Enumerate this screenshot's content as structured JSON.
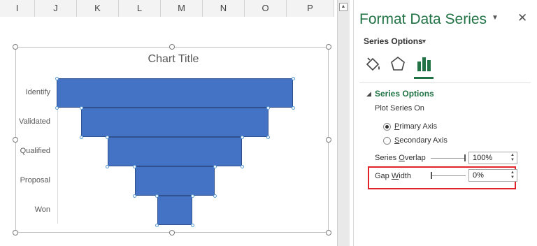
{
  "sheet": {
    "columns": [
      "I",
      "J",
      "K",
      "L",
      "M",
      "N",
      "O",
      "P"
    ]
  },
  "chart": {
    "title": "Chart Title"
  },
  "chart_data": {
    "type": "bar",
    "orientation": "horizontal",
    "style": "funnel",
    "title": "Chart Title",
    "categories": [
      "Identify",
      "Validated",
      "Qualified",
      "Proposal",
      "Won"
    ],
    "values": [
      100,
      79,
      57,
      34,
      15
    ],
    "color": "#4472c4",
    "gap_width_percent": 0,
    "series_overlap_percent": 100,
    "grid": false,
    "legend": "none"
  },
  "pane": {
    "title": "Format Data Series",
    "menu_label": "Series Options",
    "icons": [
      "fill-line-icon",
      "effects-icon",
      "series-options-icon"
    ],
    "section_title": "Series Options",
    "plot_series_on": "Plot Series On",
    "primary_axis": {
      "pre": "",
      "accel": "P",
      "post": "rimary Axis"
    },
    "secondary_axis": {
      "pre": "",
      "accel": "S",
      "post": "econdary Axis"
    },
    "series_overlap": {
      "pre": "Series ",
      "accel": "O",
      "post": "verlap",
      "value": "100%"
    },
    "gap_width": {
      "pre": "Gap ",
      "accel": "W",
      "post": "idth",
      "value": "0%"
    }
  },
  "colors": {
    "accent": "#217346",
    "bar": "#4472c4",
    "highlight": "#e0242a"
  }
}
